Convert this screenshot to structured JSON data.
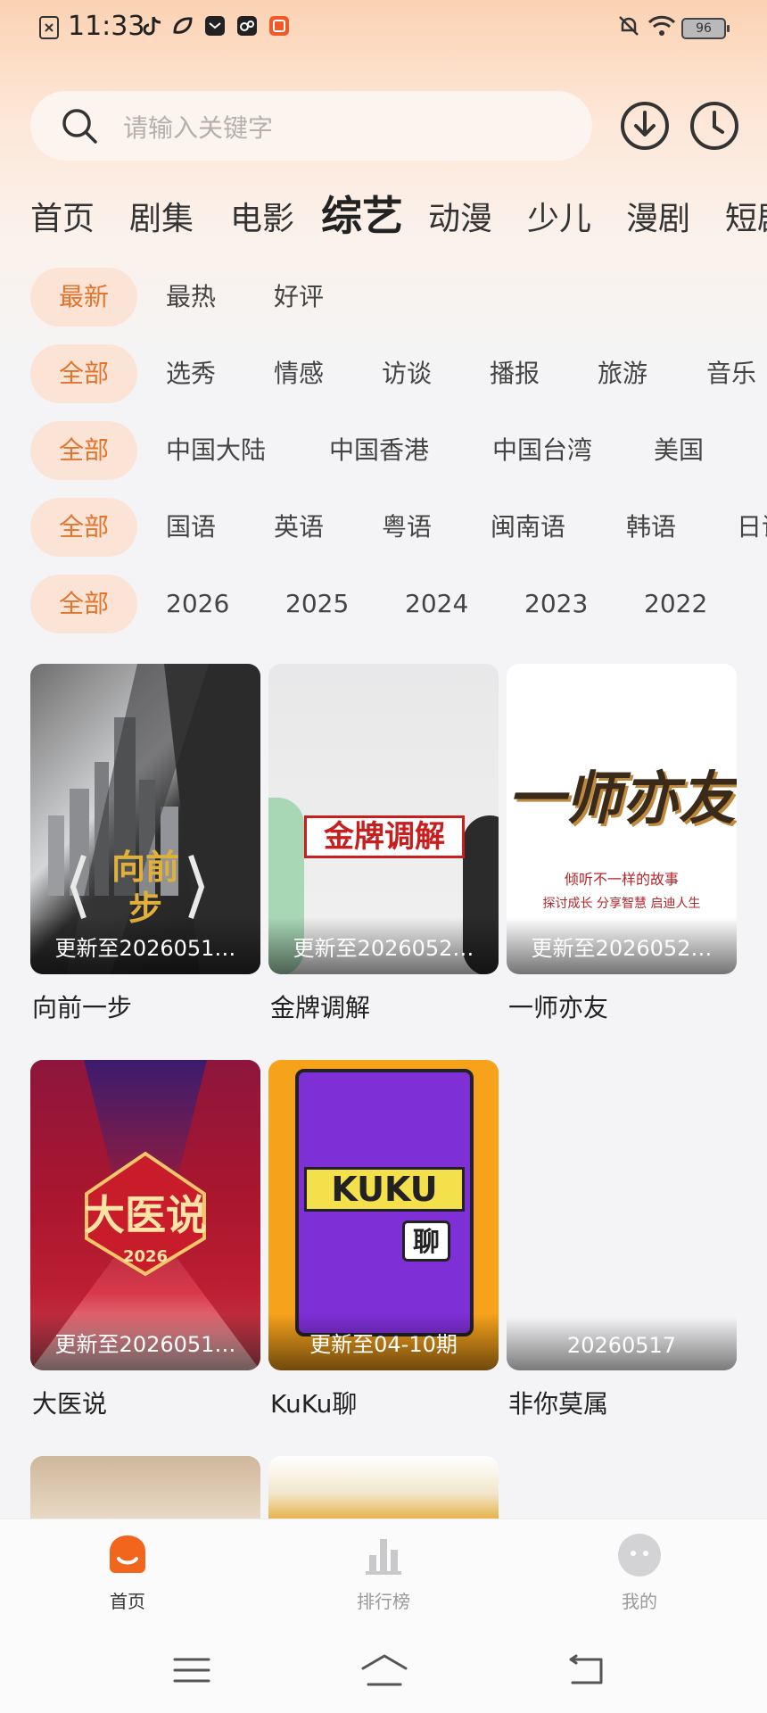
{
  "status_bar": {
    "time": "11:33",
    "battery": "96"
  },
  "search": {
    "placeholder": "请输入关键字"
  },
  "tabs": [
    "首页",
    "剧集",
    "电影",
    "综艺",
    "动漫",
    "少儿",
    "漫剧",
    "短剧"
  ],
  "active_tab": "综艺",
  "filters": {
    "sort": [
      "最新",
      "最热",
      "好评"
    ],
    "type": [
      "全部",
      "选秀",
      "情感",
      "访谈",
      "播报",
      "旅游",
      "音乐"
    ],
    "region": [
      "全部",
      "中国大陆",
      "中国香港",
      "中国台湾",
      "美国"
    ],
    "language": [
      "全部",
      "国语",
      "英语",
      "粤语",
      "闽南语",
      "韩语",
      "日语"
    ],
    "year": [
      "全部",
      "2026",
      "2025",
      "2024",
      "2023",
      "2022"
    ]
  },
  "cards": [
    {
      "title": "向前一步",
      "update": "更新至2026051…",
      "poster_text": "向前步"
    },
    {
      "title": "金牌调解",
      "update": "更新至2026052…",
      "poster_text": "金牌调解"
    },
    {
      "title": "一师亦友",
      "update": "更新至2026052…",
      "poster_text": "一师亦友",
      "poster_sub1": "倾听不一样的故事",
      "poster_sub2": "探讨成长 分享智慧 启迪人生"
    },
    {
      "title": "大医说",
      "update": "更新至2026051…",
      "poster_text": "大医说",
      "poster_sub1": "2026"
    },
    {
      "title": "KuKu聊",
      "update": "更新至04-10期",
      "poster_text": "KUKU",
      "poster_sub1": "聊"
    },
    {
      "title": "非你莫属",
      "update": "20260517"
    }
  ],
  "bottom_nav": [
    {
      "label": "首页",
      "icon": "home-face-icon"
    },
    {
      "label": "排行榜",
      "icon": "bar-chart-icon"
    },
    {
      "label": "我的",
      "icon": "profile-face-icon"
    }
  ]
}
